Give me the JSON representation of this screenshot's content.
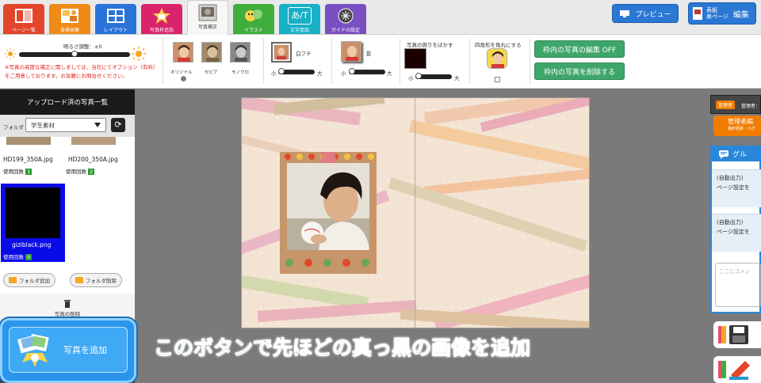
{
  "toolbar": {
    "tools": [
      {
        "label": "ページ一覧",
        "icon": "page-list-icon",
        "color": "#e2452b"
      },
      {
        "label": "背景画像",
        "icon": "background-icon",
        "color": "#f08a17"
      },
      {
        "label": "レイアウト",
        "icon": "layout-icon",
        "color": "#2a73d8"
      },
      {
        "label": "写真枠追加",
        "icon": "photo-frame-icon",
        "color": "#d9246b"
      },
      {
        "label": "写真補正",
        "icon": "photo-correction-icon",
        "color": "#9b9b9b"
      },
      {
        "label": "イラスト",
        "icon": "illustration-icon",
        "color": "#3fae3c"
      },
      {
        "label": "文字追加",
        "icon": "add-text-icon",
        "color": "#18b0c6"
      },
      {
        "label": "ガイドの設定",
        "icon": "guide-icon",
        "color": "#7a4fc2"
      }
    ],
    "text_tool_glyph": "あ/T",
    "preview_label": "プレビュー",
    "cover_label_1": "表紙",
    "cover_label_2": "扉ページ",
    "cover_edit": "編集"
  },
  "correction": {
    "brightness_label": "明るさ調整：±0",
    "notice": "※写真の高度な補正に関しましては、当社にてオプション（有料）をご用意しております。お気軽にお問合せください。",
    "color_modes": [
      "オリジナル",
      "セピア",
      "モノクロ"
    ],
    "white_border_label": "白フチ",
    "shadow_label": "影",
    "blur_label": "写真の周りをぼかす",
    "round_label": "四角形を角丸にする",
    "slider_small": "小",
    "slider_large": "大",
    "edit_off_button": "枠内の写真の編集 OFF",
    "delete_button": "枠内の写真を削除する",
    "blur_color": "#1a0000"
  },
  "sidebar": {
    "header": "アップロード済の写真一覧",
    "folder_label": "フォルダ",
    "folder_value": "学生素材",
    "files": [
      {
        "name": "HD199_350A.jpg",
        "usage_label": "使用回数",
        "usage": "1"
      },
      {
        "name": "HD200_350A.jpg",
        "usage_label": "使用回数",
        "usage": "2"
      },
      {
        "name": "giziblack.png",
        "usage_label": "使用回数",
        "usage": "0"
      }
    ],
    "add_folder": "フォルダ追加",
    "delete_folder": "フォルダ削除",
    "delete_photo": "写真の削除",
    "add_photo": "写真を追加"
  },
  "right_panel": {
    "manager_badge": "管理者",
    "manager_text": "管理者：",
    "manager_edit": "管理者編",
    "manager_edit_sub": "最終更新・ログ",
    "group_title": "グル",
    "messages": [
      {
        "line1": "(自動出力)",
        "line2": "ページ設定を"
      },
      {
        "line1": "(自動出力)",
        "line2": "ページ設定を"
      }
    ],
    "comment_placeholder": "ここにコメン"
  },
  "caption": "このボタンで先ほどの真っ黒の画像を追加"
}
